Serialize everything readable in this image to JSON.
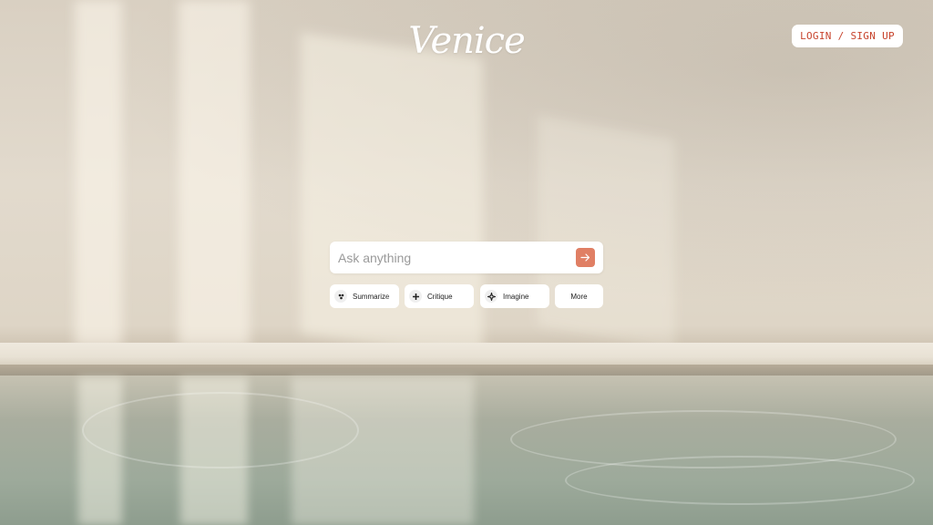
{
  "header": {
    "logo_text": "Venice",
    "login_label": "LOGIN / SIGN UP"
  },
  "search": {
    "placeholder": "Ask anything",
    "value": "",
    "submit_icon": "arrow-right-icon"
  },
  "chips": [
    {
      "label": "Summarize",
      "icon": "summarize-icon"
    },
    {
      "label": "Critique",
      "icon": "plus-icon"
    },
    {
      "label": "Imagine",
      "icon": "sparkle-icon"
    },
    {
      "label": "More",
      "icon": ""
    }
  ],
  "colors": {
    "accent": "#e07f64",
    "login_text": "#c7432c",
    "logo": "#ffffff"
  }
}
